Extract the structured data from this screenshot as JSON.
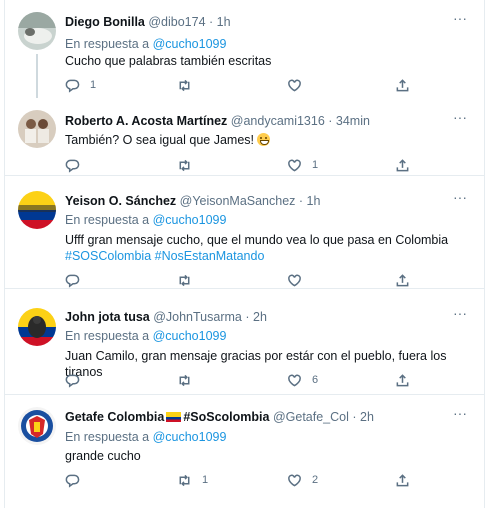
{
  "reply_prefix": "En respuesta a",
  "tweets": [
    {
      "name": "Diego Bonilla",
      "handle": "@dibo174",
      "time": "· 1h",
      "reply_to": "@cucho1099",
      "text": "Cucho que palabras también escritas",
      "hashtags": "",
      "replies": "1",
      "retweets": "",
      "likes": ""
    },
    {
      "name": "Roberto A. Acosta Martínez",
      "handle": "@andycami1316",
      "time": "· 34min",
      "reply_to": "",
      "text": "También? O sea igual que James!",
      "emoji": "grinning-face-emoji",
      "hashtags": "",
      "replies": "",
      "retweets": "",
      "likes": "1"
    },
    {
      "name": "Yeison O. Sánchez",
      "handle": "@YeisonMaSanchez",
      "time": "· 1h",
      "reply_to": "@cucho1099",
      "text": "Ufff gran mensaje cucho, que el mundo vea lo que pasa en Colombia",
      "hashtags": "#SOSColombia #NosEstanMatando",
      "replies": "",
      "retweets": "",
      "likes": ""
    },
    {
      "name": "John jota tusa",
      "handle": "@JohnTusarma",
      "time": "· 2h",
      "reply_to": "@cucho1099",
      "text": "Juan Camilo, gran mensaje gracias por estár con el pueblo, fuera los tiranos",
      "hashtags": "",
      "replies": "",
      "retweets": "",
      "likes": "6"
    },
    {
      "name": "Getafe Colombia",
      "name_suffix": "#SoScolombia",
      "handle": "@Getafe_Col",
      "time": "· 2h",
      "reply_to": "@cucho1099",
      "text": "grande cucho",
      "hashtags": "",
      "replies": "",
      "retweets": "1",
      "likes": "2"
    }
  ],
  "colors": {
    "accent": "#1b95e0",
    "muted": "#5b7083",
    "border": "#e6ecf0"
  },
  "icons": [
    "more-icon",
    "reply-icon",
    "retweet-icon",
    "like-icon",
    "share-icon",
    "colombia-flag-icon"
  ]
}
